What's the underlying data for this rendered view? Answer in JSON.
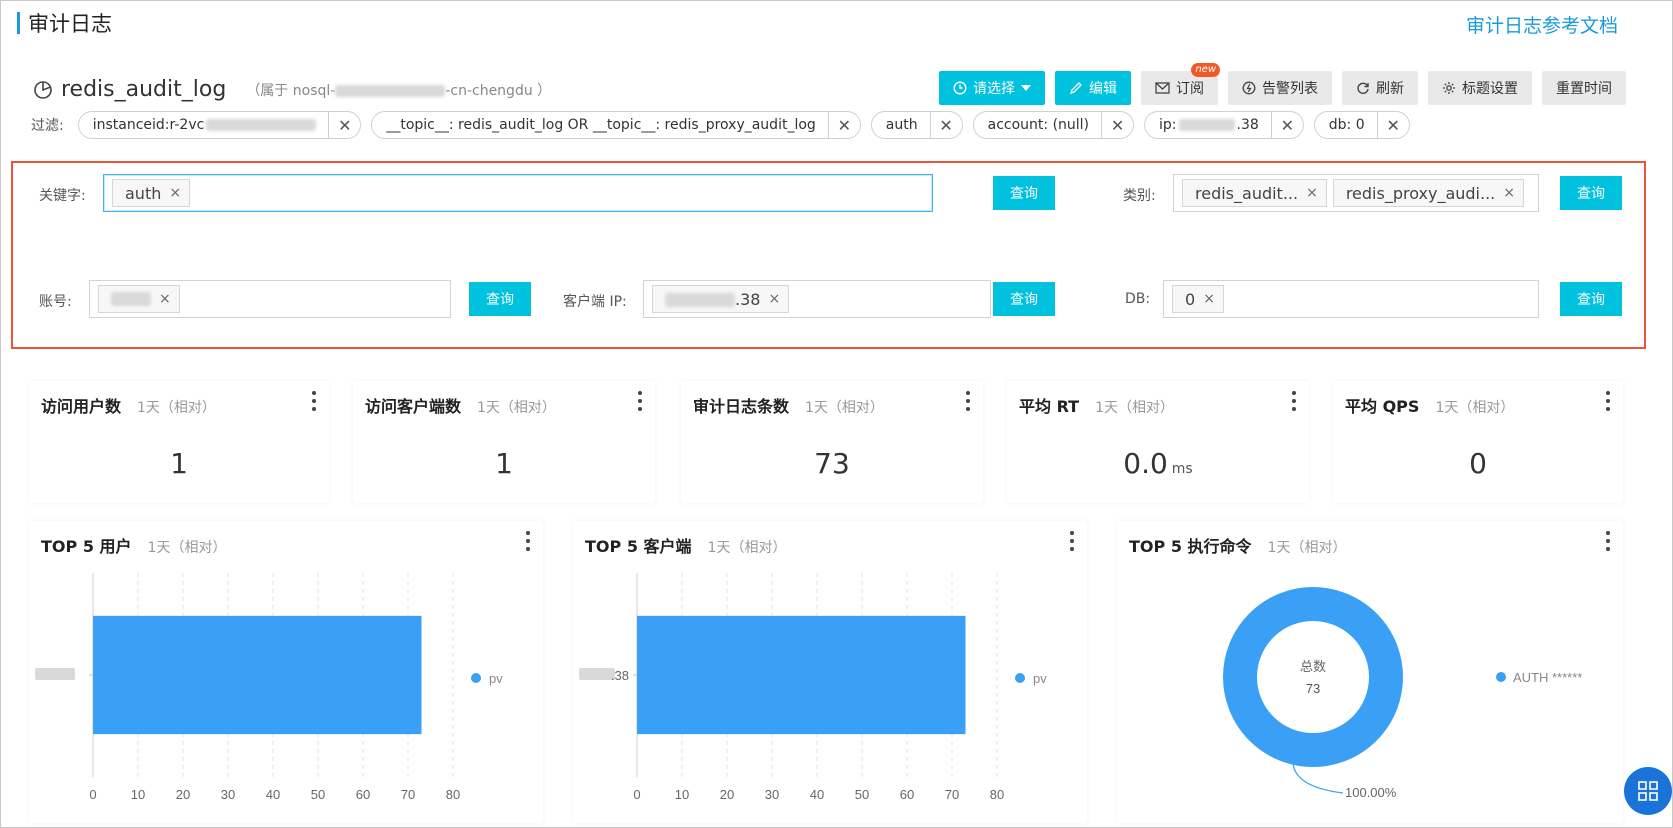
{
  "page": {
    "title": "审计日志",
    "doc_link": "审计日志参考文档"
  },
  "logstore": {
    "name": "redis_audit_log",
    "meta_prefix": "（属于 nosql-",
    "meta_suffix": "-cn-chengdu ）"
  },
  "toolbar": {
    "select_label": "请选择",
    "edit_label": "编辑",
    "subscribe_label": "订阅",
    "new_badge": "new",
    "alerts_label": "告警列表",
    "refresh_label": "刷新",
    "title_settings_label": "标题设置",
    "reset_time_label": "重置时间"
  },
  "filters": {
    "label": "过滤:",
    "chips": [
      {
        "text": "instanceid:r-2vc"
      },
      {
        "text": "__topic__: redis_audit_log OR __topic__: redis_proxy_audit_log"
      },
      {
        "text": "auth"
      },
      {
        "text": "account: (null)"
      },
      {
        "text": "ip:",
        "suffix": ".38"
      },
      {
        "text": "db: 0"
      }
    ]
  },
  "query": {
    "keyword_label": "关键字:",
    "keyword_tag": "auth",
    "category_label": "类别:",
    "category_tags": [
      "redis_audit...",
      "redis_proxy_audi..."
    ],
    "account_label": "账号:",
    "client_ip_label": "客户端 IP:",
    "client_ip_suffix": ".38",
    "db_label": "DB:",
    "db_tag": "0",
    "query_button": "查询",
    "tag_close": "×"
  },
  "stats": [
    {
      "title": "访问用户数",
      "sub": "1天（相对）",
      "value": "1",
      "unit": ""
    },
    {
      "title": "访问客户端数",
      "sub": "1天（相对）",
      "value": "1",
      "unit": ""
    },
    {
      "title": "审计日志条数",
      "sub": "1天（相对）",
      "value": "73",
      "unit": ""
    },
    {
      "title": "平均 RT",
      "sub": "1天（相对）",
      "value": "0.0",
      "unit": "ms"
    },
    {
      "title": "平均 QPS",
      "sub": "1天（相对）",
      "value": "0",
      "unit": ""
    }
  ],
  "chart_data": [
    {
      "type": "bar",
      "orientation": "horizontal",
      "title": "TOP 5 用户",
      "subtitle": "1天（相对）",
      "categories": [
        ""
      ],
      "series": [
        {
          "name": "pv",
          "values": [
            73
          ]
        }
      ],
      "xlim": [
        0,
        80
      ],
      "xticks": [
        0,
        10,
        20,
        30,
        40,
        50,
        60,
        70,
        80
      ],
      "color": "#3aa0f5",
      "legend": "right"
    },
    {
      "type": "bar",
      "orientation": "horizontal",
      "title": "TOP 5 客户端",
      "subtitle": "1天（相对）",
      "categories": [
        ".38"
      ],
      "series": [
        {
          "name": "pv",
          "values": [
            73
          ]
        }
      ],
      "xlim": [
        0,
        80
      ],
      "xticks": [
        0,
        10,
        20,
        30,
        40,
        50,
        60,
        70,
        80
      ],
      "color": "#3aa0f5",
      "legend": "right"
    },
    {
      "type": "pie",
      "title": "TOP 5 执行命令",
      "subtitle": "1天（相对）",
      "center_label": "总数",
      "center_value": "73",
      "slices": [
        {
          "name": "AUTH ******",
          "value": 73,
          "percent": "100.00%"
        }
      ],
      "color": "#3aa0f5",
      "legend": "right"
    }
  ],
  "colors": {
    "accent": "#00c1de",
    "link": "#1a9bd6",
    "highlight_border": "#e8553a",
    "bar": "#3aa0f5"
  }
}
